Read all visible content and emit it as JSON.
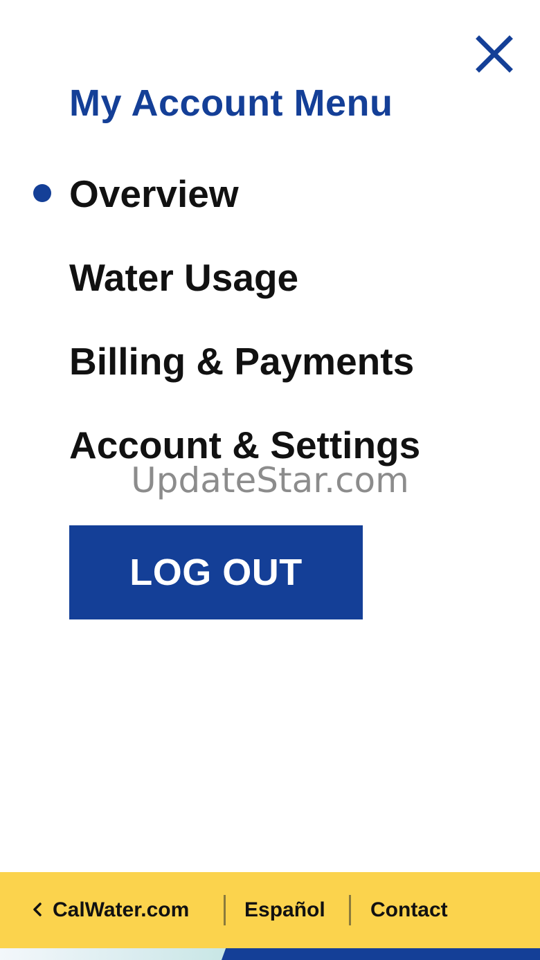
{
  "menu": {
    "title": "My Account Menu",
    "close_icon": "close-icon",
    "items": [
      {
        "label": "Overview",
        "active": true
      },
      {
        "label": "Water Usage",
        "active": false
      },
      {
        "label": "Billing & Payments",
        "active": false
      },
      {
        "label": "Account & Settings",
        "active": false
      }
    ],
    "logout_label": "LOG OUT"
  },
  "watermark": "UpdateStar.com",
  "footer": {
    "links": [
      {
        "label": "CalWater.com",
        "icon": "chevron-left-icon"
      },
      {
        "label": "Español"
      },
      {
        "label": "Contact"
      }
    ]
  },
  "colors": {
    "accent": "#143f97",
    "footer_bg": "#fbd34d",
    "text": "#111111",
    "watermark": "#8c8c8c"
  }
}
